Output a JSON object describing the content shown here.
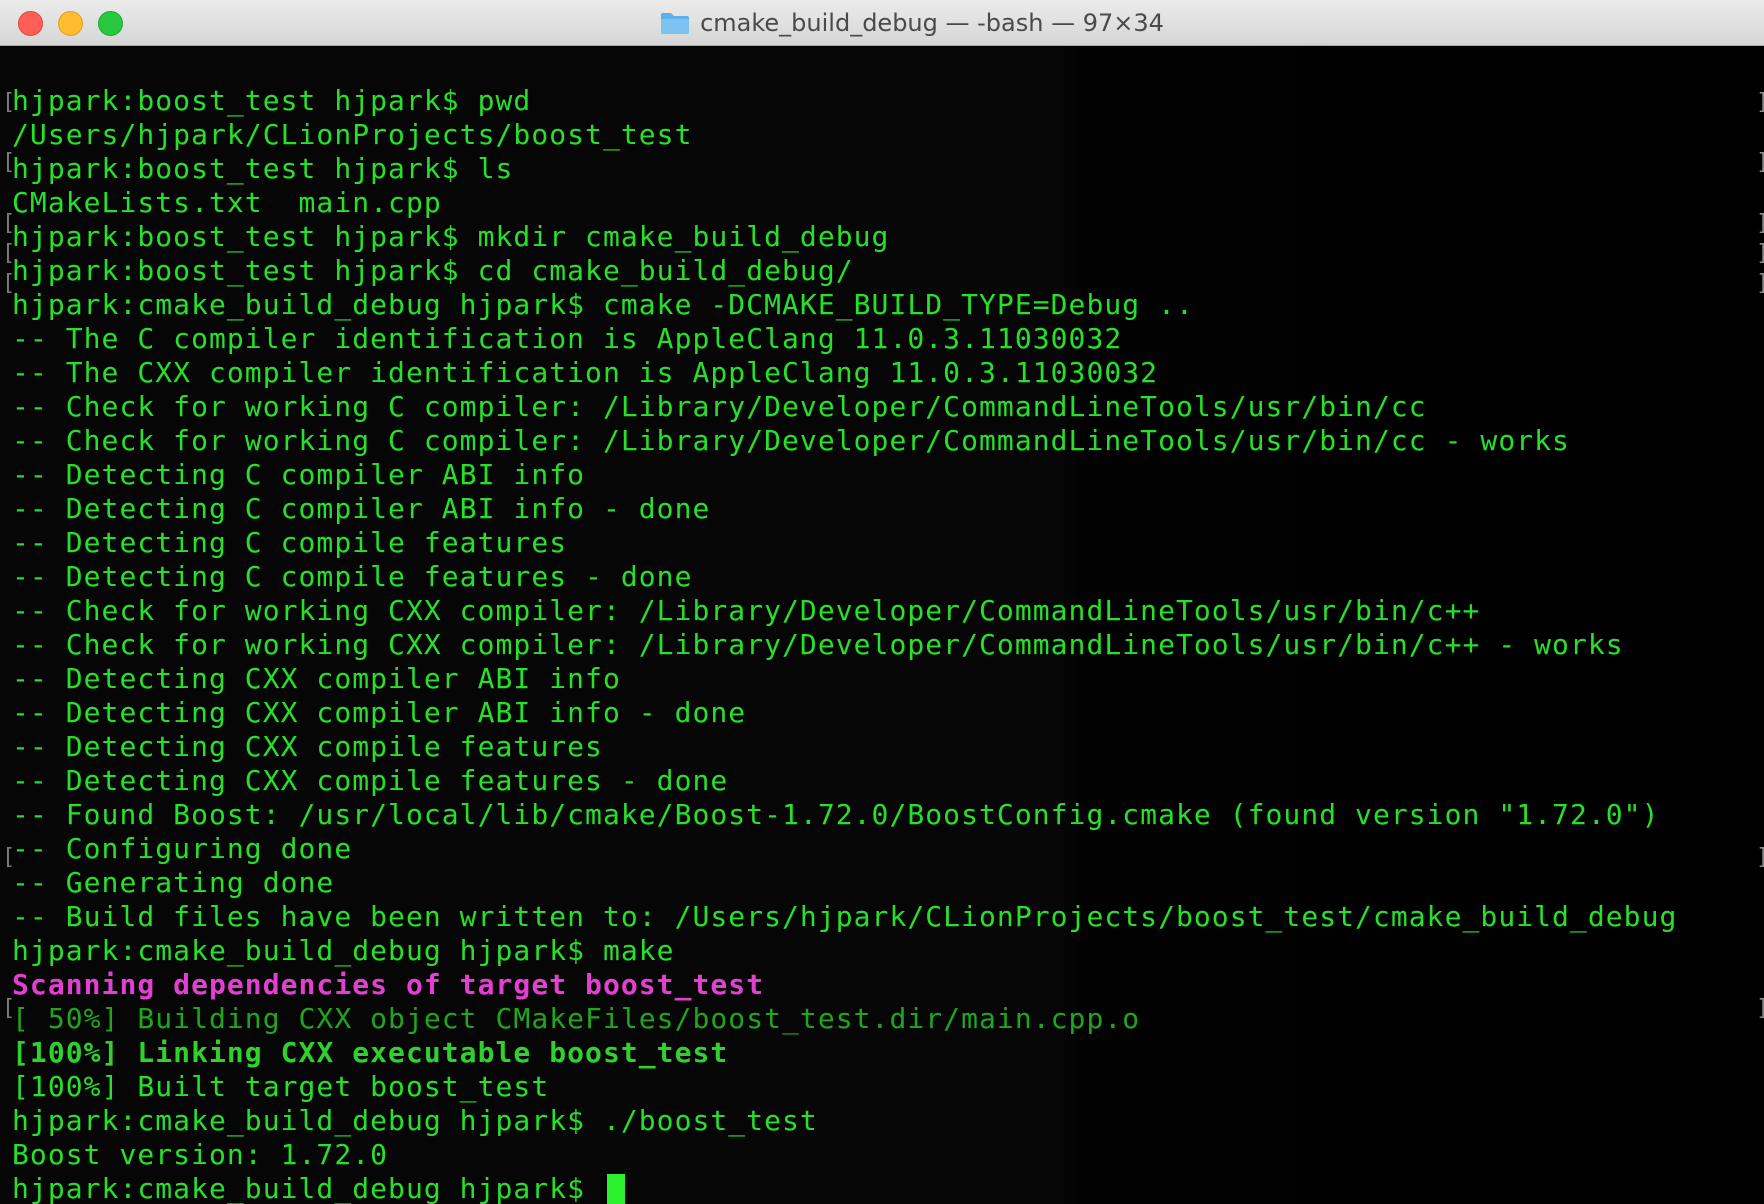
{
  "window": {
    "title": "cmake_build_debug — -bash — 97×34",
    "folder_icon": "folder-icon",
    "colors": {
      "close": "#ff5f57",
      "minimize": "#febc2e",
      "zoom": "#28c840",
      "terminal_text": "#27e02a",
      "highlight_text": "#e33fd0",
      "background": "#000000"
    }
  },
  "terminal": {
    "lines": [
      "hjpark:boost_test hjpark$ pwd",
      "/Users/hjpark/CLionProjects/boost_test",
      "hjpark:boost_test hjpark$ ls",
      "CMakeLists.txt  main.cpp",
      "hjpark:boost_test hjpark$ mkdir cmake_build_debug",
      "hjpark:boost_test hjpark$ cd cmake_build_debug/",
      "hjpark:cmake_build_debug hjpark$ cmake -DCMAKE_BUILD_TYPE=Debug ..",
      "-- The C compiler identification is AppleClang 11.0.3.11030032",
      "-- The CXX compiler identification is AppleClang 11.0.3.11030032",
      "-- Check for working C compiler: /Library/Developer/CommandLineTools/usr/bin/cc",
      "-- Check for working C compiler: /Library/Developer/CommandLineTools/usr/bin/cc - works",
      "-- Detecting C compiler ABI info",
      "-- Detecting C compiler ABI info - done",
      "-- Detecting C compile features",
      "-- Detecting C compile features - done",
      "-- Check for working CXX compiler: /Library/Developer/CommandLineTools/usr/bin/c++",
      "-- Check for working CXX compiler: /Library/Developer/CommandLineTools/usr/bin/c++ - works",
      "-- Detecting CXX compiler ABI info",
      "-- Detecting CXX compiler ABI info - done",
      "-- Detecting CXX compile features",
      "-- Detecting CXX compile features - done",
      "-- Found Boost: /usr/local/lib/cmake/Boost-1.72.0/BoostConfig.cmake (found version \"1.72.0\")",
      "-- Configuring done",
      "-- Generating done",
      "-- Build files have been written to: /Users/hjpark/CLionProjects/boost_test/cmake_build_debug",
      "hjpark:cmake_build_debug hjpark$ make",
      "Scanning dependencies of target boost_test",
      "[ 50%] Building CXX object CMakeFiles/boost_test.dir/main.cpp.o",
      "[100%] Linking CXX executable boost_test",
      "[100%] Built target boost_test",
      "hjpark:cmake_build_debug hjpark$ ./boost_test",
      "Boost version: 1.72.0",
      "hjpark:cmake_build_debug hjpark$ "
    ]
  }
}
